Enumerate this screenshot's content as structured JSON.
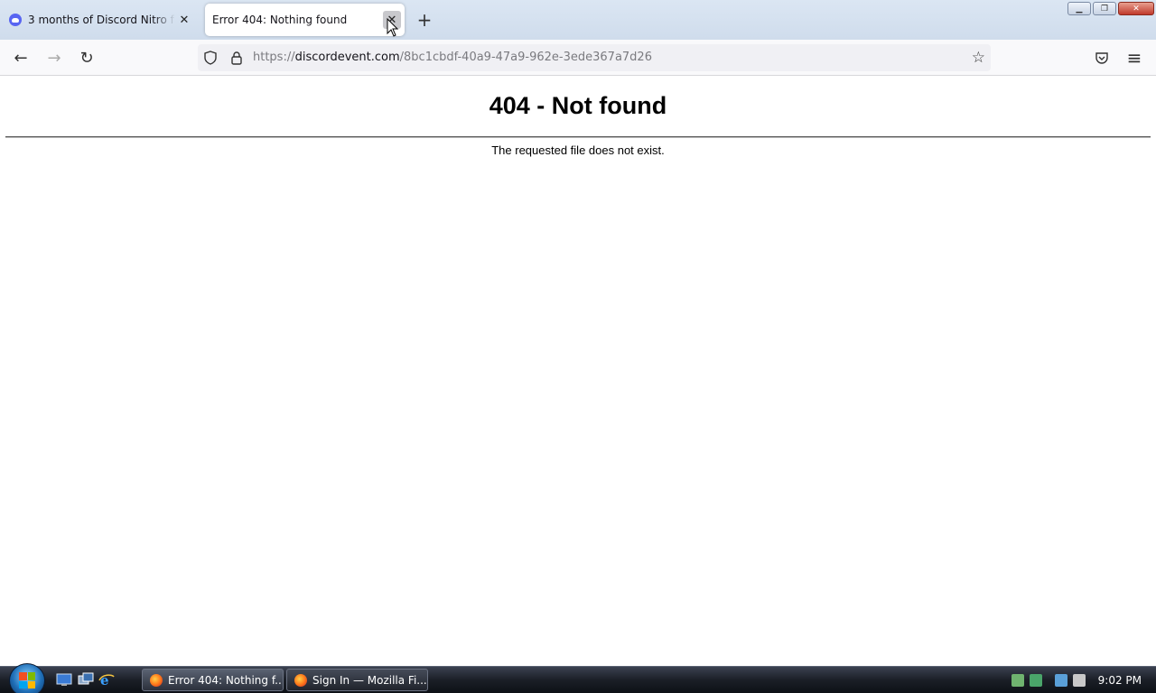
{
  "browser": {
    "tabs": [
      {
        "title": "3 months of Discord Nitro free | Discord",
        "active": false,
        "favicon": "discord-icon"
      },
      {
        "title": "Error 404: Nothing found",
        "active": true,
        "favicon": ""
      }
    ],
    "close_glyph": "✕",
    "new_tab_glyph": "+",
    "url": {
      "scheme": "https://",
      "host": "discordevent.com",
      "path": "/8bc1cbdf-40a9-47a9-962e-3ede367a7d26"
    },
    "icons": {
      "back": "←",
      "forward": "→",
      "reload": "↻",
      "bookmark": "☆",
      "menu": "≡"
    }
  },
  "page": {
    "heading": "404 - Not found",
    "message": "The requested file does not exist."
  },
  "taskbar": {
    "tasks": [
      {
        "label": "Error 404: Nothing f...",
        "active": true
      },
      {
        "label": "Sign In — Mozilla Fi...",
        "active": false
      }
    ],
    "clock": "9:02 PM"
  },
  "colors": {
    "discord_brand": "#5865f2",
    "tab_strip": "#d6e2f0",
    "toolbar": "#f9f9fb",
    "urlbar": "#f0f0f4"
  }
}
